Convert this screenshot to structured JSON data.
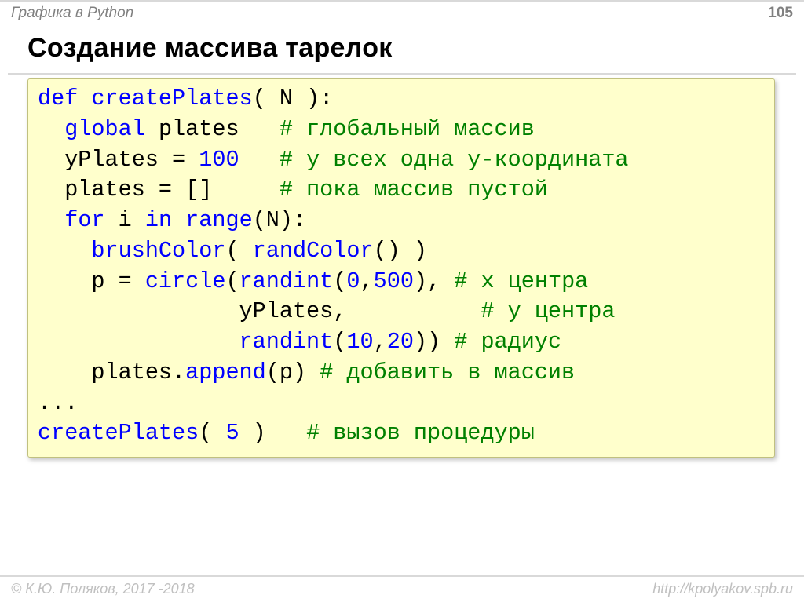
{
  "header": {
    "left": "Графика в Python",
    "page": "105"
  },
  "title": "Создание массива тарелок",
  "code": {
    "l01": {
      "kw1": "def",
      "fn": "createPlates",
      "rest": "( N ):"
    },
    "l02": {
      "kw": "global",
      "txt": " plates   ",
      "com": "# глобальный массив"
    },
    "l03": {
      "txt1": "  yPlates = ",
      "num": "100",
      "txt2": "   ",
      "com": "# у всех одна y-координата"
    },
    "l04": {
      "txt": "  plates = []     ",
      "com": "# пока массив пустой"
    },
    "l05": {
      "kw1": "for",
      "txt1": " i ",
      "kw2": "in",
      "txt2": " ",
      "fn": "range",
      "rest": "(N):"
    },
    "l06": {
      "txt1": "    ",
      "fn1": "brushColor",
      "txt2": "( ",
      "fn2": "randColor",
      "rest": "() )"
    },
    "l07": {
      "txt1": "    p = ",
      "fn1": "circle",
      "txt2": "(",
      "fn2": "randint",
      "txt3": "(",
      "n1": "0",
      "c": ",",
      "n2": "500",
      "txt4": "), ",
      "com": "# x центра"
    },
    "l08": {
      "pad": "               yPlates,          ",
      "com": "# y центра"
    },
    "l09": {
      "pad": "               ",
      "fn": "randint",
      "o": "(",
      "n1": "10",
      "c": ",",
      "n2": "20",
      "r": ")) ",
      "com": "# радиус"
    },
    "l10": {
      "txt1": "    plates.",
      "fn": "append",
      "txt2": "(p) ",
      "com": "# добавить в массив"
    },
    "l11": "...",
    "l12": {
      "fn": "createPlates",
      "txt1": "( ",
      "num": "5",
      "txt2": " )   ",
      "com": "# вызов процедуры"
    }
  },
  "footer": {
    "left": "© К.Ю. Поляков, 2017 -2018",
    "right": "http://kpolyakov.spb.ru"
  }
}
